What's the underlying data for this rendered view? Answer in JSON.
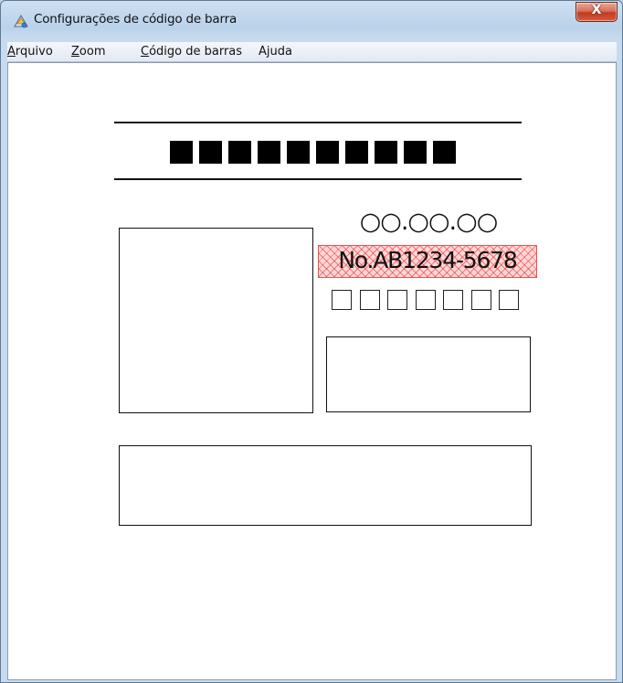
{
  "window": {
    "title": "Configurações de código de barra",
    "close_label": "X"
  },
  "menubar": {
    "items": [
      {
        "accel": "A",
        "rest": "rquivo"
      },
      {
        "accel": "Z",
        "rest": "oom"
      },
      {
        "accel": "C",
        "rest": "ódigo de barras"
      },
      {
        "accel": "",
        "rest": "Ajuda"
      }
    ]
  },
  "label": {
    "barcode_block_count": 10,
    "circles_text": "○○.○○.○○",
    "serial_text": "No.AB1234-5678",
    "small_square_count": 7
  },
  "colors": {
    "selection_highlight": "#ff3b3b",
    "selection_fill": "#ffd8d8"
  }
}
